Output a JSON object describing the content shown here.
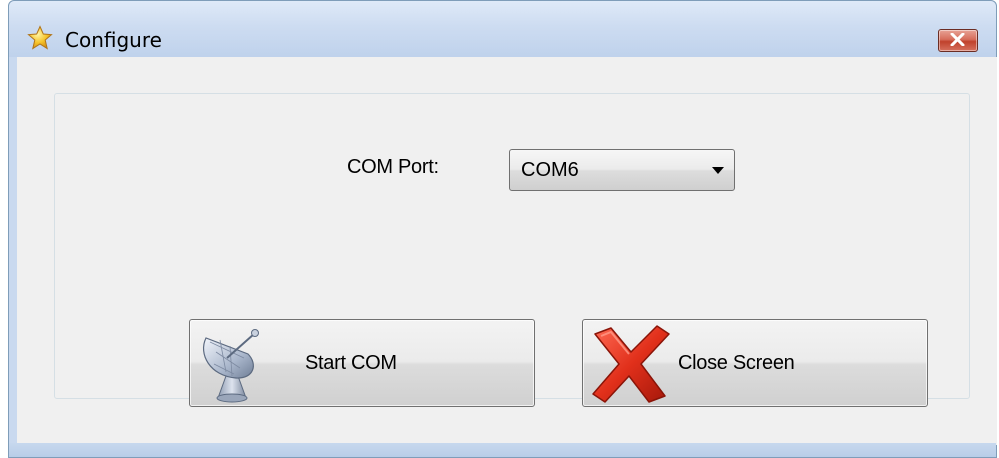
{
  "window": {
    "title": "Configure",
    "title_icon": "star-icon",
    "close_icon": "close-icon"
  },
  "form": {
    "com_port_label": "COM Port:",
    "com_port_value": "COM6"
  },
  "buttons": {
    "start_label": "Start COM",
    "start_icon": "satellite-dish-icon",
    "close_label": "Close Screen",
    "close_icon": "red-x-icon"
  },
  "colors": {
    "titlebar": "#cddcf1",
    "client_bg": "#f0f0f0",
    "close_button": "#c0412c"
  }
}
